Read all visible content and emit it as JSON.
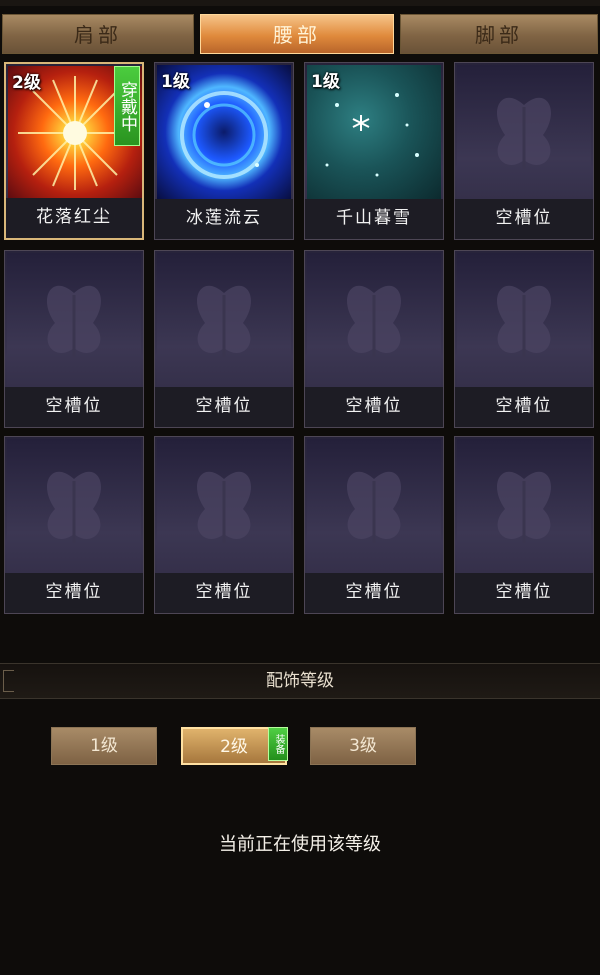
{
  "tabs": [
    {
      "label": "肩部",
      "active": false
    },
    {
      "label": "腰部",
      "active": true
    },
    {
      "label": "脚部",
      "active": false
    }
  ],
  "slots": [
    {
      "name": "花落红尘",
      "level": "2级",
      "badge": "穿戴中",
      "art": "sun-icon"
    },
    {
      "name": "冰莲流云",
      "level": "1级",
      "badge": "",
      "art": "ice-orb-icon"
    },
    {
      "name": "千山暮雪",
      "level": "1级",
      "badge": "",
      "art": "snowflake-icon"
    },
    {
      "name": "空槽位"
    },
    {
      "name": "空槽位"
    },
    {
      "name": "空槽位"
    },
    {
      "name": "空槽位"
    },
    {
      "name": "空槽位"
    },
    {
      "name": "空槽位"
    },
    {
      "name": "空槽位"
    },
    {
      "name": "空槽位"
    },
    {
      "name": "空槽位"
    }
  ],
  "section": {
    "title": "配饰等级"
  },
  "levels": [
    {
      "label": "1级",
      "active": false
    },
    {
      "label": "2级",
      "active": true,
      "badge": "装备"
    },
    {
      "label": "3级",
      "active": false
    }
  ],
  "status_text": "当前正在使用该等级",
  "colors": {
    "active_tab": "#e08a3c",
    "equip_badge": "#2a9420",
    "slot_bg": "#3a3550"
  }
}
